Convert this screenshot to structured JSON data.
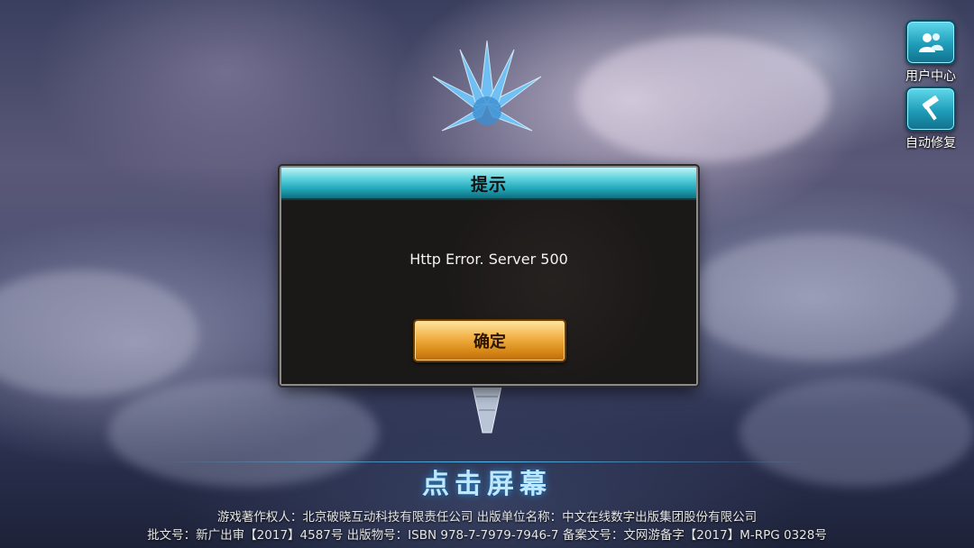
{
  "side_buttons": {
    "user_center": "用户中心",
    "auto_repair": "自动修复"
  },
  "dialog": {
    "title": "提示",
    "message": "Http Error. Server 500",
    "confirm_label": "确定"
  },
  "footer": {
    "tap_screen": "点击屏幕",
    "line1": "游戏著作权人：北京破晓互动科技有限责任公司 出版单位名称：中文在线数字出版集团股份有限公司",
    "line2": "批文号：新广出审【2017】4587号 出版物号：ISBN 978-7-7979-7946-7 备案文号：文网游备字【2017】M-RPG 0328号"
  },
  "colors": {
    "accent_cyan": "#1fa6b8",
    "button_gold": "#f3b34a",
    "tap_glow": "#2d8fd6"
  }
}
